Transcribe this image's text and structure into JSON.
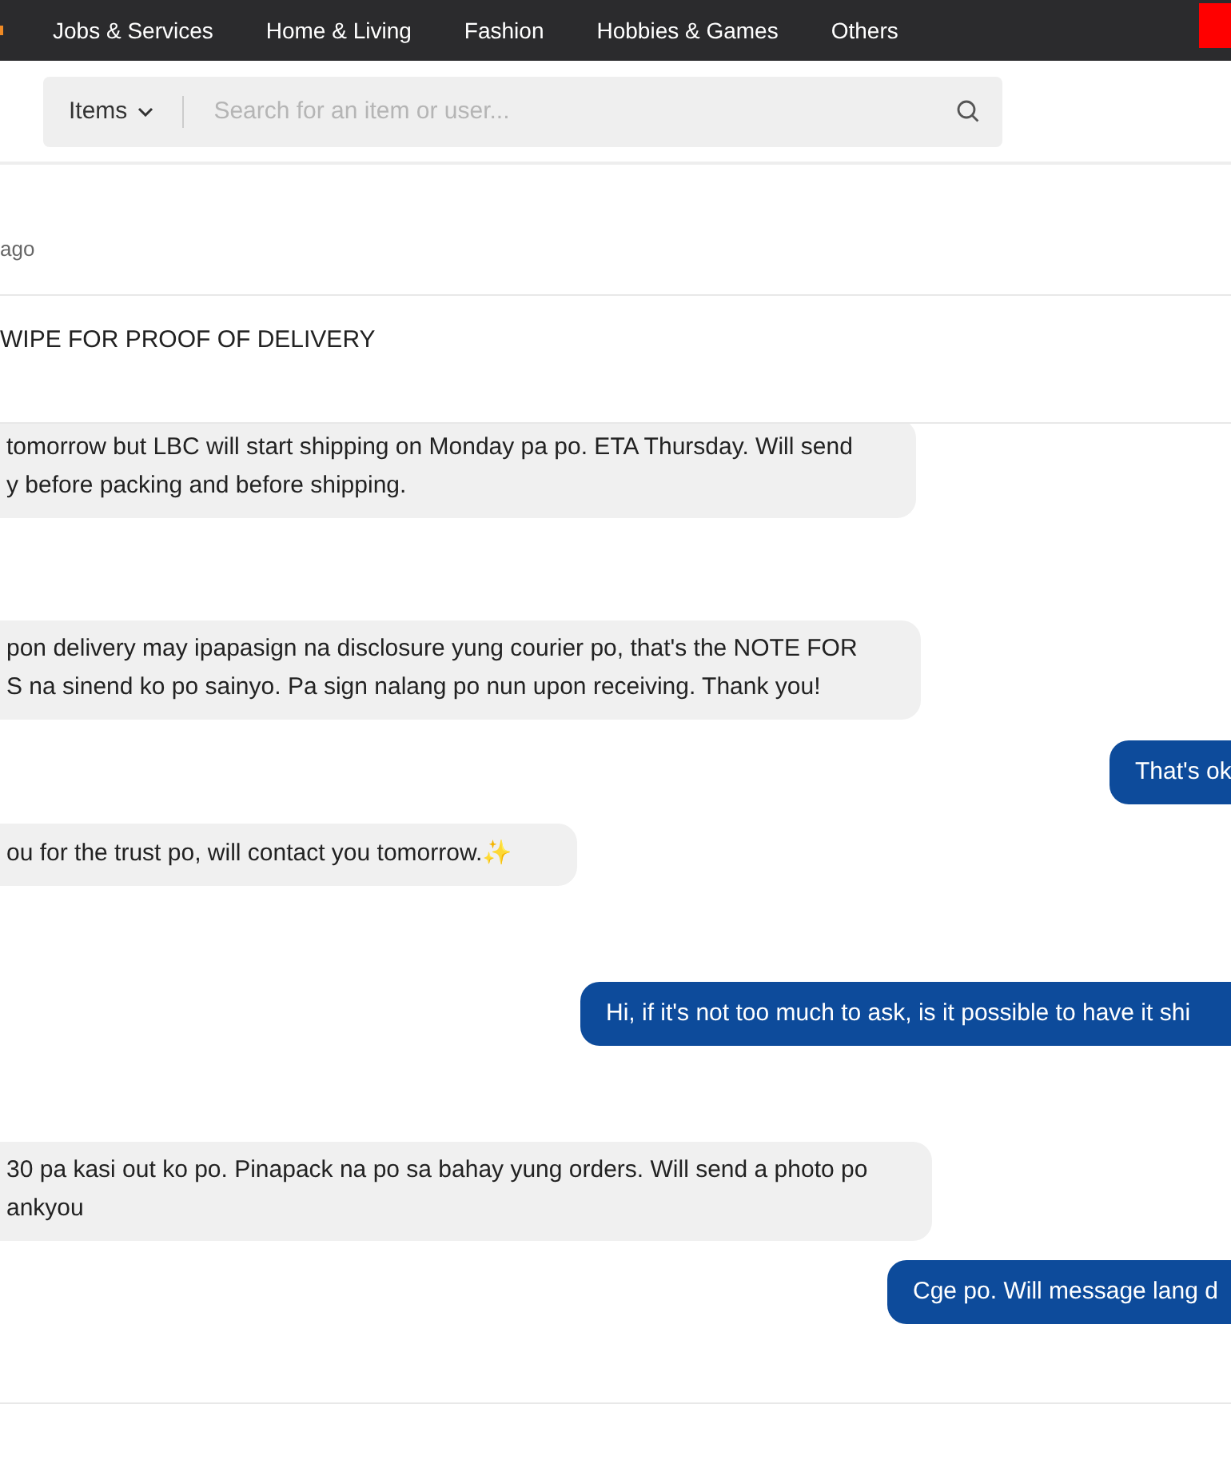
{
  "nav": {
    "items": [
      "Jobs & Services",
      "Home & Living",
      "Fashion",
      "Hobbies & Games",
      "Others"
    ]
  },
  "search": {
    "category": "Items",
    "placeholder": "Search for an item or user..."
  },
  "header": {
    "time": "ago",
    "note": "WIPE FOR PROOF OF DELIVERY"
  },
  "messages": [
    {
      "kind": "received",
      "text": "tomorrow but LBC will start shipping on Monday pa po. ETA Thursday. Will send\ny before packing and before shipping."
    },
    {
      "kind": "received",
      "text": "pon delivery may ipapasign na disclosure yung courier po, that's the NOTE FOR\nS na sinend ko po sainyo. Pa sign nalang po nun upon receiving. Thank you!"
    },
    {
      "kind": "sent",
      "text": "That's ok"
    },
    {
      "kind": "received",
      "text": "ou for the trust po, will contact you tomorrow.",
      "emoji": "✨"
    },
    {
      "kind": "sent",
      "text": "Hi, if it's not too much to ask, is it possible to have it shi"
    },
    {
      "kind": "received",
      "text": "30 pa kasi out ko po. Pinapack na po sa bahay yung orders. Will send a photo po\nankyou"
    },
    {
      "kind": "sent",
      "text": "Cge po. Will message lang d"
    }
  ]
}
